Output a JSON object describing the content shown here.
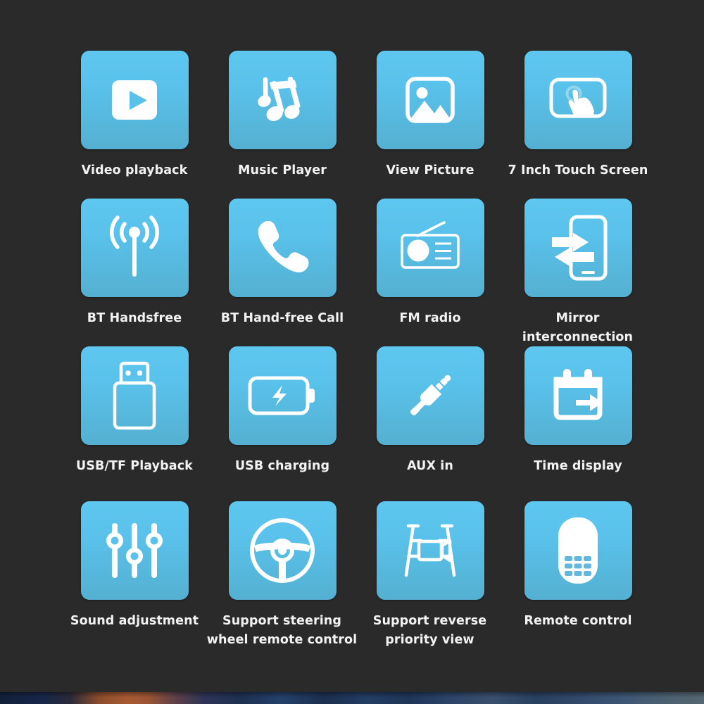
{
  "page": {
    "background_color": "#2a2a2a",
    "tile_gradient_top": "#5ec7f0",
    "tile_gradient_bottom": "#55b0d2",
    "label_color": "#f2f2f2",
    "icon_color": "#ffffff"
  },
  "features": [
    {
      "id": "video-playback",
      "label": "Video playback",
      "icon": "play-video-icon"
    },
    {
      "id": "music-player",
      "label": "Music Player",
      "icon": "music-note-icon"
    },
    {
      "id": "view-picture",
      "label": "View Picture",
      "icon": "photo-image-icon"
    },
    {
      "id": "touch-screen",
      "label": "7 Inch Touch Screen",
      "icon": "touch-screen-icon"
    },
    {
      "id": "bt-handsfree",
      "label": "BT Handsfree",
      "icon": "antenna-signal-icon"
    },
    {
      "id": "bt-hands-free-call",
      "label": "BT Hand-free Call",
      "icon": "phone-handset-icon"
    },
    {
      "id": "fm-radio",
      "label": "FM radio",
      "icon": "radio-icon"
    },
    {
      "id": "mirror-interconnection",
      "label": "Mirror interconnection",
      "icon": "phone-mirror-arrows-icon"
    },
    {
      "id": "usb-tf-playback",
      "label": "USB/TF Playback",
      "icon": "usb-drive-icon"
    },
    {
      "id": "usb-charging",
      "label": "USB charging",
      "icon": "battery-bolt-icon"
    },
    {
      "id": "aux-in",
      "label": "AUX in",
      "icon": "audio-jack-icon"
    },
    {
      "id": "time-display",
      "label": "Time display",
      "icon": "calendar-arrow-icon"
    },
    {
      "id": "sound-adjustment",
      "label": "Sound adjustment",
      "icon": "equalizer-sliders-icon"
    },
    {
      "id": "steering-wheel-control",
      "label": "Support steering wheel remote control",
      "icon": "steering-wheel-icon"
    },
    {
      "id": "reverse-priority-view",
      "label": "Support reverse priority view",
      "icon": "reverse-camera-icon"
    },
    {
      "id": "remote-control",
      "label": "Remote control",
      "icon": "remote-keypad-icon"
    }
  ]
}
